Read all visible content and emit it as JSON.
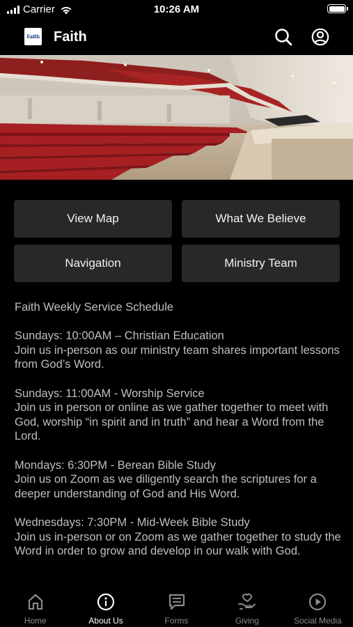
{
  "status_bar": {
    "carrier": "Carrier",
    "time": "10:26 AM"
  },
  "header": {
    "logo_text": "Faith",
    "title": "Faith",
    "search_icon": "search-icon",
    "account_icon": "account-icon"
  },
  "hero": {
    "description_icon": "sanctuary-photo"
  },
  "buttons": [
    {
      "label": "View Map"
    },
    {
      "label": "What We Believe"
    },
    {
      "label": "Navigation"
    },
    {
      "label": "Ministry Team"
    }
  ],
  "schedule": {
    "heading": "Faith Weekly Service Schedule",
    "entries": [
      {
        "title": "Sundays: 10:00AM – Christian Education",
        "body": "Join us in-person as our ministry team shares important lessons from God’s Word."
      },
      {
        "title": "Sundays: 11:00AM - Worship Service",
        "body": "Join us in person or online as we gather together to meet with God, worship “in spirit and in truth” and hear a Word from the Lord."
      },
      {
        "title": "Mondays: 6:30PM - Berean Bible Study",
        "body": "Join us on Zoom as we diligently search the scriptures for a deeper understanding of God and His Word."
      },
      {
        "title": "Wednesdays: 7:30PM - Mid-Week Bible Study",
        "body": "Join us in-person or on Zoom as we gather together to study the Word in order to grow and develop in our walk with God."
      }
    ]
  },
  "tabbar": {
    "active": "About Us",
    "tabs": [
      {
        "label": "Home",
        "icon": "home-icon"
      },
      {
        "label": "About Us",
        "icon": "info-icon"
      },
      {
        "label": "Forms",
        "icon": "forms-icon"
      },
      {
        "label": "Giving",
        "icon": "giving-icon"
      },
      {
        "label": "Social Media",
        "icon": "play-icon"
      }
    ]
  },
  "colors": {
    "background": "#000000",
    "button_bg": "#282828",
    "body_text": "#bfbfbf",
    "inactive_tab": "#8a8a8a"
  }
}
